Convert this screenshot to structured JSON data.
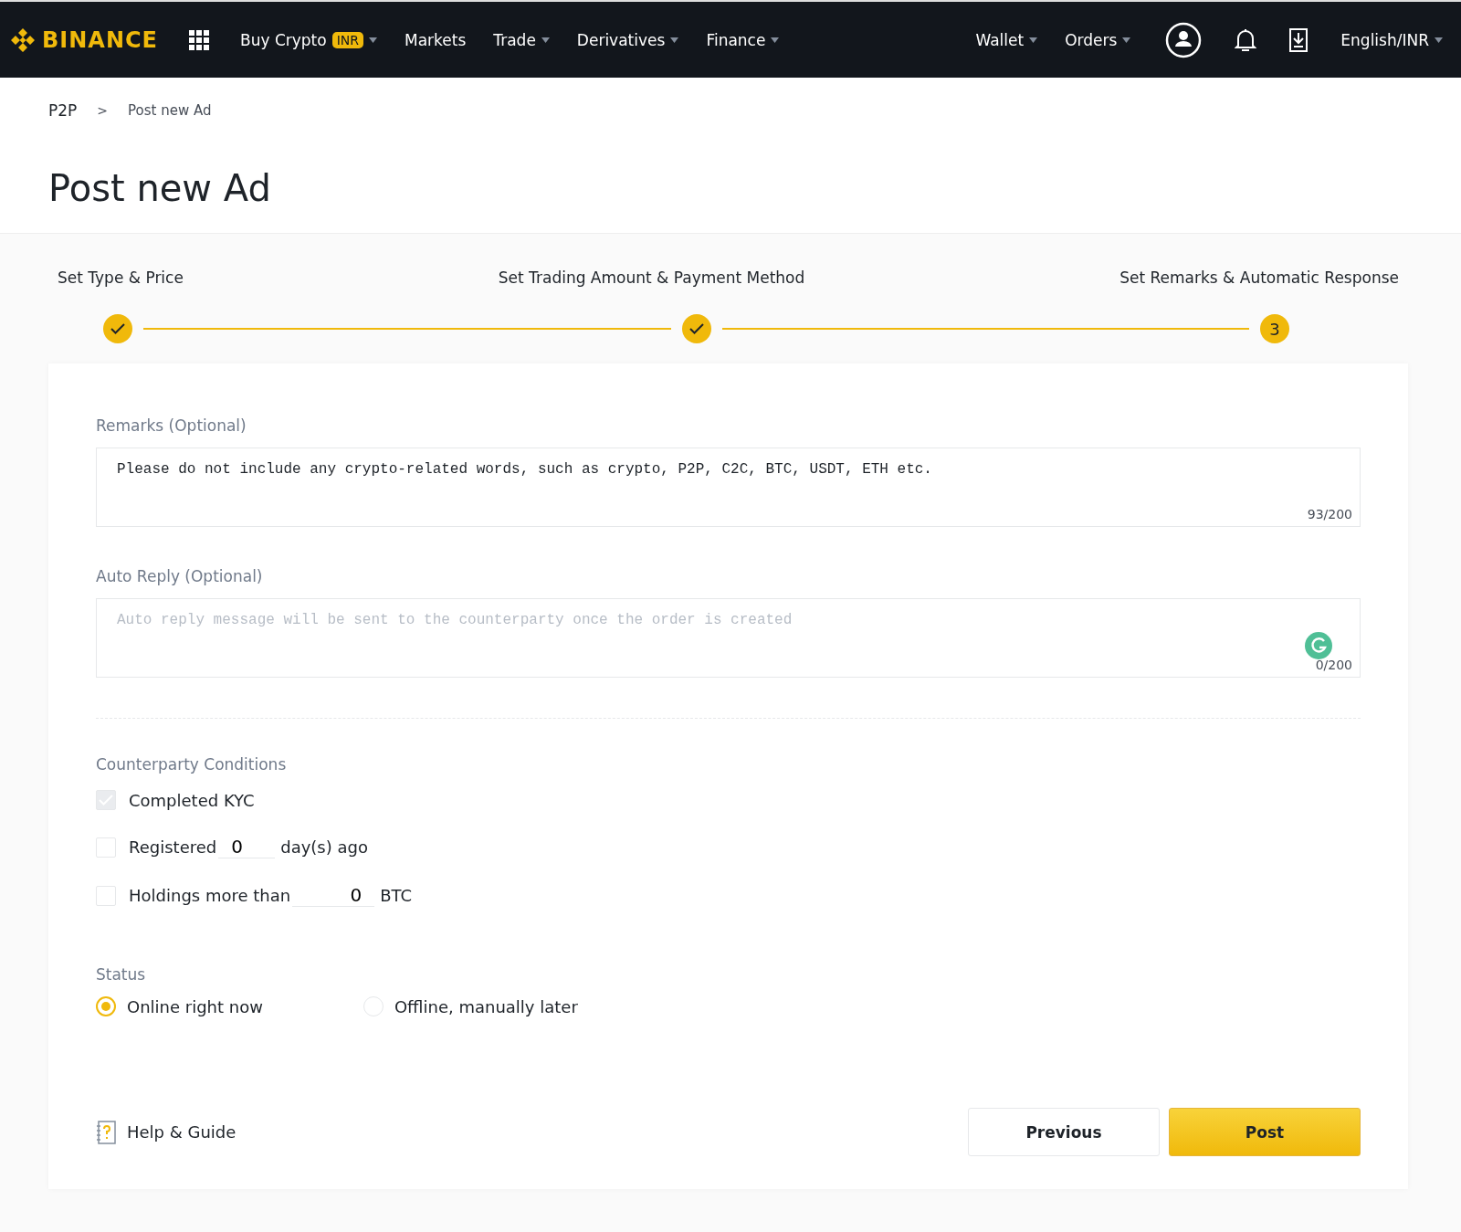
{
  "nav": {
    "logo": "BINANCE",
    "items": [
      {
        "label": "Buy Crypto",
        "badge": "INR",
        "dropdown": true
      },
      {
        "label": "Markets",
        "dropdown": false
      },
      {
        "label": "Trade",
        "dropdown": true
      },
      {
        "label": "Derivatives",
        "dropdown": true
      },
      {
        "label": "Finance",
        "dropdown": true
      }
    ],
    "right_items": [
      {
        "label": "Wallet",
        "dropdown": true
      },
      {
        "label": "Orders",
        "dropdown": true
      }
    ],
    "language": "English/INR"
  },
  "breadcrumb": [
    "P2P",
    "Post new Ad"
  ],
  "breadcrumb_separator": ">",
  "title": "Post new Ad",
  "steps": [
    {
      "label": "Set Type & Price",
      "done": true
    },
    {
      "label": "Set Trading Amount & Payment Method",
      "done": true
    },
    {
      "label": "Set Remarks & Automatic Response",
      "done": false,
      "number": "3"
    }
  ],
  "remarks": {
    "label": "Remarks (Optional)",
    "value": "Please do not include any crypto-related words, such as crypto, P2P, C2C, BTC, USDT, ETH etc.",
    "counter": "93/200"
  },
  "auto_reply": {
    "label": "Auto Reply (Optional)",
    "placeholder": "Auto reply message will be sent to the counterparty once the order is created",
    "counter": "0/200"
  },
  "conditions": {
    "label": "Counterparty Conditions",
    "items": [
      {
        "kind": "plain",
        "label": "Completed KYC",
        "checked": true,
        "disabled": true
      },
      {
        "kind": "input",
        "label": "Registered",
        "value": "0",
        "suffix": "day(s) ago",
        "checked": false,
        "disabled": false
      },
      {
        "kind": "input",
        "label": "Holdings more than",
        "value": "0",
        "suffix": "BTC",
        "checked": false,
        "disabled": false
      }
    ]
  },
  "status": {
    "label": "Status",
    "options": [
      {
        "label": "Online right now",
        "selected": true
      },
      {
        "label": "Offline, manually later",
        "selected": false
      }
    ]
  },
  "help": "Help & Guide",
  "buttons": [
    {
      "label": "Previous",
      "kind": "secondary"
    },
    {
      "label": "Post",
      "kind": "primary"
    }
  ]
}
